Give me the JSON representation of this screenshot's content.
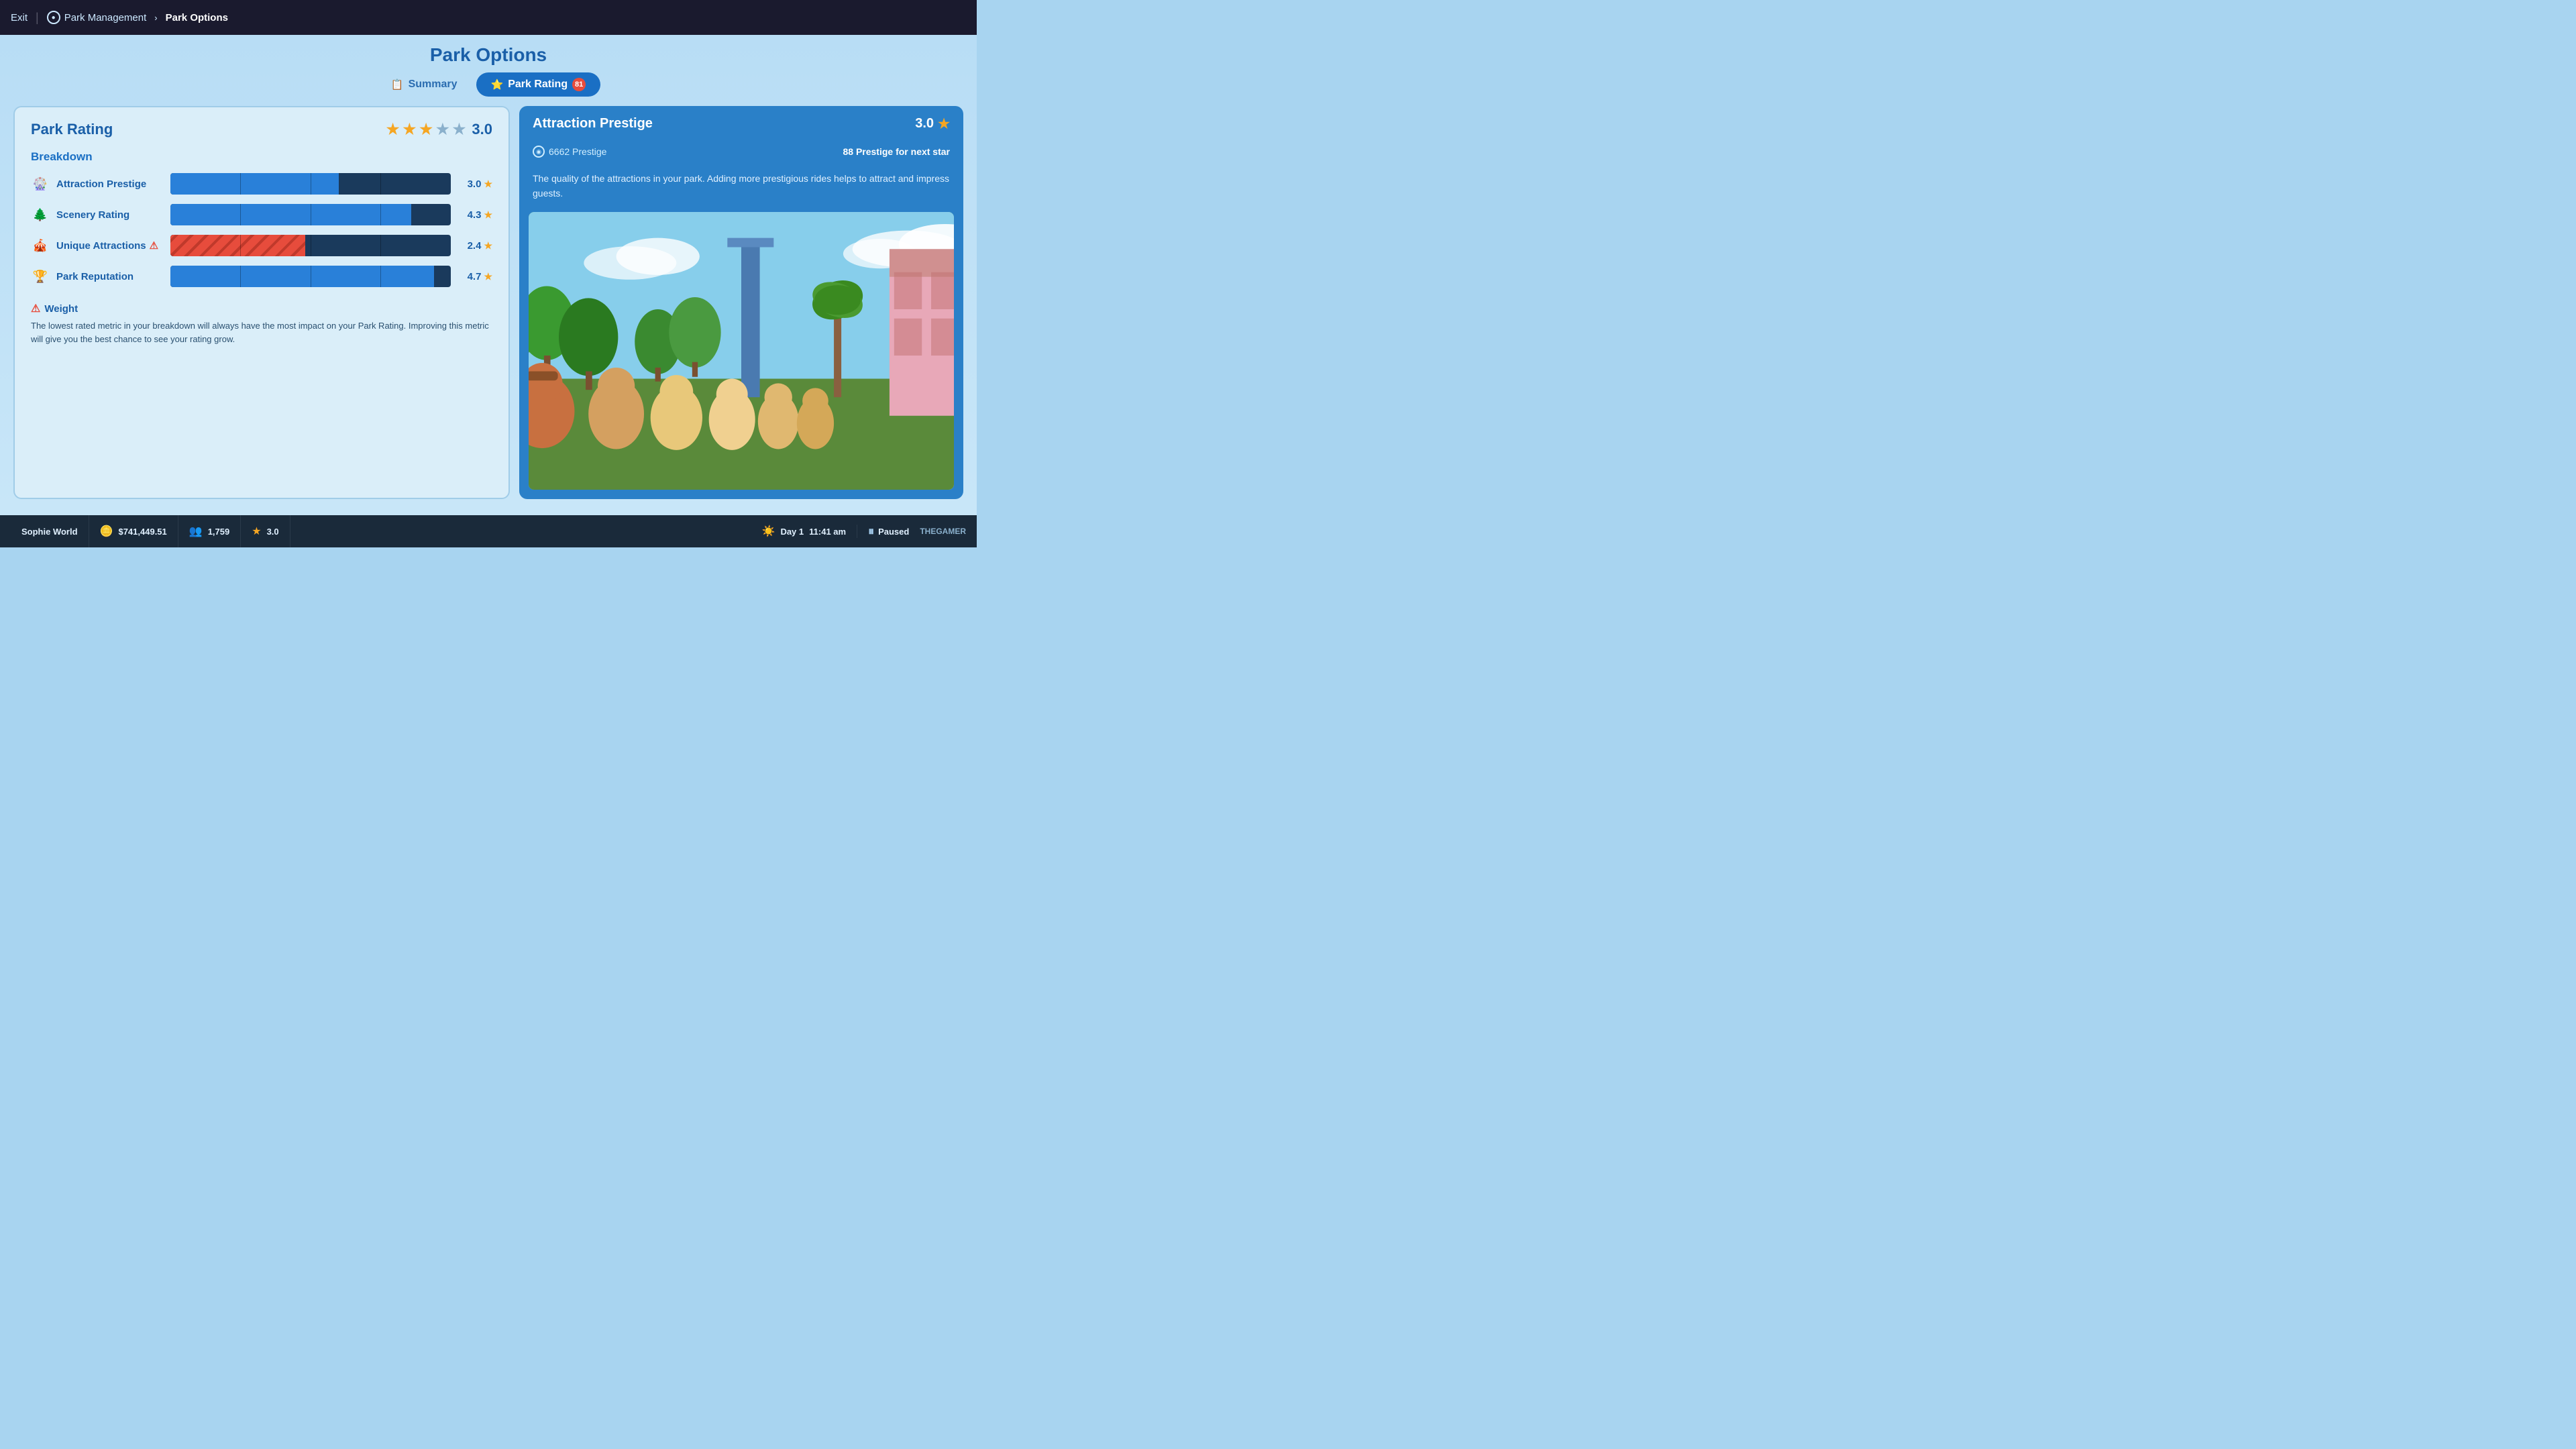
{
  "nav": {
    "exit_label": "Exit",
    "park_management_label": "Park Management",
    "park_options_label": "Park Options"
  },
  "header": {
    "page_title": "Park Options"
  },
  "tabs": [
    {
      "id": "summary",
      "label": "Summary",
      "icon": "📋",
      "active": false,
      "badge": null
    },
    {
      "id": "park_rating",
      "label": "Park Rating",
      "icon": "⭐",
      "active": true,
      "badge": "81"
    }
  ],
  "left_panel": {
    "title": "Park Rating",
    "rating_value": "3.0",
    "stars": [
      {
        "type": "filled"
      },
      {
        "type": "filled"
      },
      {
        "type": "filled"
      },
      {
        "type": "empty"
      },
      {
        "type": "empty"
      }
    ],
    "breakdown_title": "Breakdown",
    "metrics": [
      {
        "id": "attraction_prestige",
        "label": "Attraction Prestige",
        "icon": "🎡",
        "bar_pct": 60,
        "bar_type": "blue",
        "value": "3.0",
        "has_warning": false
      },
      {
        "id": "scenery_rating",
        "label": "Scenery Rating",
        "icon": "🌲",
        "bar_pct": 86,
        "bar_type": "blue",
        "value": "4.3",
        "has_warning": false
      },
      {
        "id": "unique_attractions",
        "label": "Unique Attractions",
        "icon": "🎪",
        "bar_pct": 48,
        "bar_type": "red",
        "value": "2.4",
        "has_warning": true
      },
      {
        "id": "park_reputation",
        "label": "Park Reputation",
        "icon": "🏆",
        "bar_pct": 94,
        "bar_type": "blue",
        "value": "4.7",
        "has_warning": false
      }
    ],
    "weight_title": "Weight",
    "weight_text": "The lowest rated metric in your breakdown will always have the most impact on your Park Rating. Improving this metric will give you the best chance to see your rating grow."
  },
  "right_panel": {
    "title": "Attraction Prestige",
    "rating_value": "3.0",
    "prestige_count": "6662 Prestige",
    "next_star_text": "88 Prestige for next star",
    "description": "The quality of the attractions in your park. Adding more prestigious rides helps to attract and impress guests."
  },
  "status_bar": {
    "park_name": "Sophie World",
    "money": "$741,449.51",
    "guests": "1,759",
    "rating": "3.0",
    "day_label": "Day 1",
    "time": "11:41 am",
    "paused_label": "Paused",
    "thegamer_label": "THEGAMER"
  }
}
